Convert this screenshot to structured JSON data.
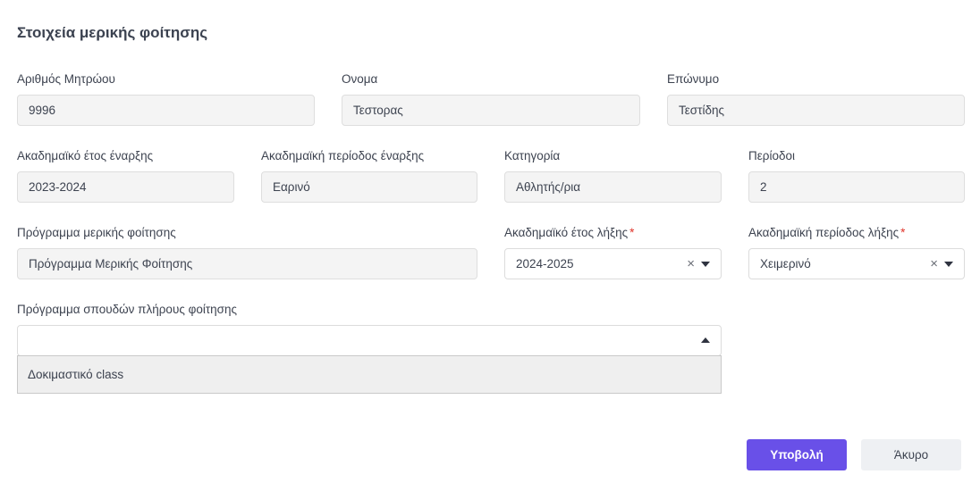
{
  "form": {
    "title": "Στοιχεία μερικής φοίτησης",
    "registry_number": {
      "label": "Αριθμός Μητρώου",
      "value": "9996"
    },
    "first_name": {
      "label": "Ονομα",
      "value": "Τεστορας"
    },
    "last_name": {
      "label": "Επώνυμο",
      "value": "Τεστίδης"
    },
    "start_year": {
      "label": "Ακαδημαϊκό έτος έναρξης",
      "value": "2023-2024"
    },
    "start_period": {
      "label": "Ακαδημαϊκή περίοδος έναρξης",
      "value": "Εαρινό"
    },
    "category": {
      "label": "Κατηγορία",
      "value": "Αθλητής/ρια"
    },
    "periods": {
      "label": "Περίοδοι",
      "value": "2"
    },
    "program": {
      "label": "Πρόγραμμα μερικής φοίτησης",
      "value": "Πρόγραμμα Μερικής Φοίτησης"
    },
    "end_year": {
      "label": "Ακαδημαϊκό έτος λήξης",
      "required_mark": "*",
      "value": "2024-2025",
      "clear_glyph": "×"
    },
    "end_period": {
      "label": "Ακαδημαϊκή περίοδος λήξης",
      "required_mark": "*",
      "value": "Χειμερινό",
      "clear_glyph": "×"
    },
    "full_program": {
      "label": "Πρόγραμμα σπουδών πλήρους φοίτησης",
      "value": "",
      "options": [
        "Δοκιμαστικό class"
      ]
    }
  },
  "actions": {
    "submit_label": "Υποβολή",
    "cancel_label": "Άκυρο"
  },
  "colors": {
    "primary": "#6950e8",
    "required": "#e0342a",
    "readonly_bg": "#f4f4f4"
  }
}
